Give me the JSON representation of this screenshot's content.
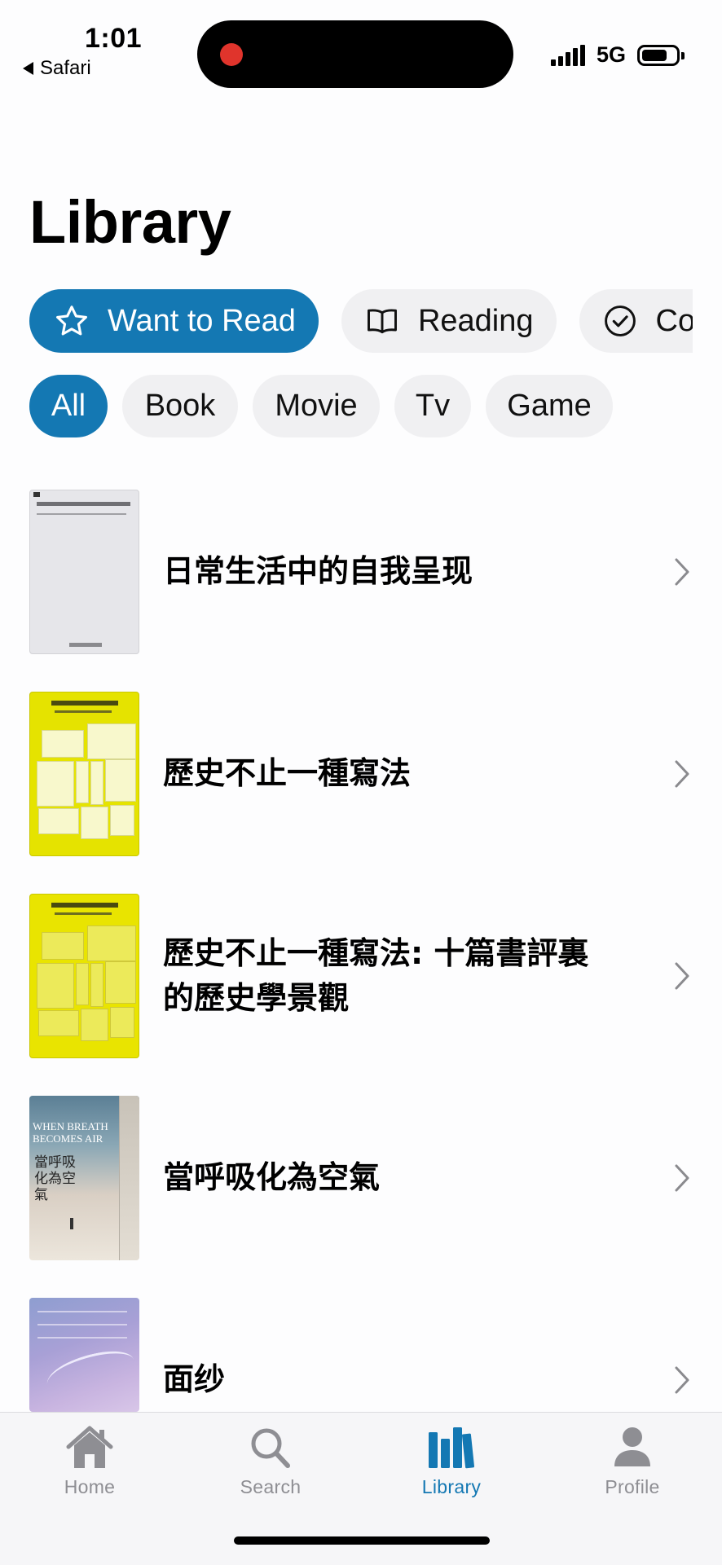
{
  "status_bar": {
    "time": "1:01",
    "back_app": "Safari",
    "network": "5G"
  },
  "page": {
    "title": "Library"
  },
  "status_filters": [
    {
      "label": "Want to Read",
      "icon": "star-icon",
      "active": true
    },
    {
      "label": "Reading",
      "icon": "book-open-icon",
      "active": false
    },
    {
      "label": "Con",
      "icon": "checkmark-circle-icon",
      "active": false
    }
  ],
  "type_filters": [
    {
      "label": "All",
      "active": true
    },
    {
      "label": "Book",
      "active": false
    },
    {
      "label": "Movie",
      "active": false
    },
    {
      "label": "Tv",
      "active": false
    },
    {
      "label": "Game",
      "active": false
    }
  ],
  "items": [
    {
      "title": "日常生活中的自我呈现"
    },
    {
      "title": "歷史不止一種寫法"
    },
    {
      "title": "歷史不止一種寫法: 十篇書評裏的歷史學景觀"
    },
    {
      "title": "當呼吸化為空氣"
    },
    {
      "title": "面纱"
    }
  ],
  "covers": {
    "item_3_en": "WHEN BREATH BECOMES AIR",
    "item_3_cn": "當呼吸化為空氣"
  },
  "tabbar": {
    "tabs": [
      {
        "label": "Home",
        "icon": "house-icon",
        "active": false
      },
      {
        "label": "Search",
        "icon": "magnifier-icon",
        "active": false
      },
      {
        "label": "Library",
        "icon": "library-books-icon",
        "active": true
      },
      {
        "label": "Profile",
        "icon": "person-icon",
        "active": false
      }
    ]
  },
  "colors": {
    "accent": "#1478b3",
    "pill_bg": "#f0f0f2",
    "tab_inactive": "#8e8e93",
    "record_dot": "#e0342c"
  }
}
